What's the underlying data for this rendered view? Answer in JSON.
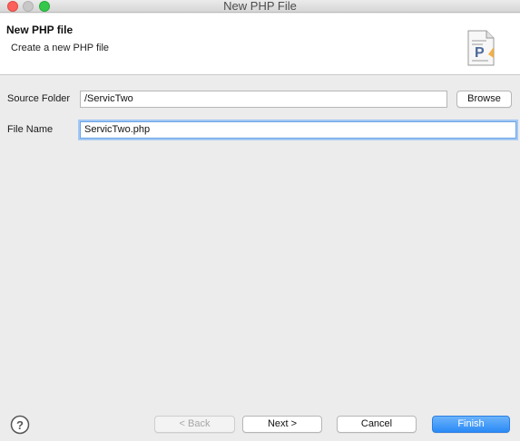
{
  "window": {
    "title": "New PHP File"
  },
  "header": {
    "title": "New PHP file",
    "description": "Create a new PHP file",
    "icon": "php-file-icon"
  },
  "form": {
    "source_folder": {
      "label": "Source Folder",
      "value": "/ServicTwo"
    },
    "browse_label": "Browse",
    "file_name": {
      "label": "File Name",
      "value": "ServicTwo.php"
    }
  },
  "footer": {
    "help_icon": "question-icon",
    "back_label": "< Back",
    "next_label": "Next >",
    "cancel_label": "Cancel",
    "finish_label": "Finish"
  },
  "colors": {
    "accent": "#2a8af6",
    "close": "#fc605c",
    "maximize": "#34c84a"
  }
}
